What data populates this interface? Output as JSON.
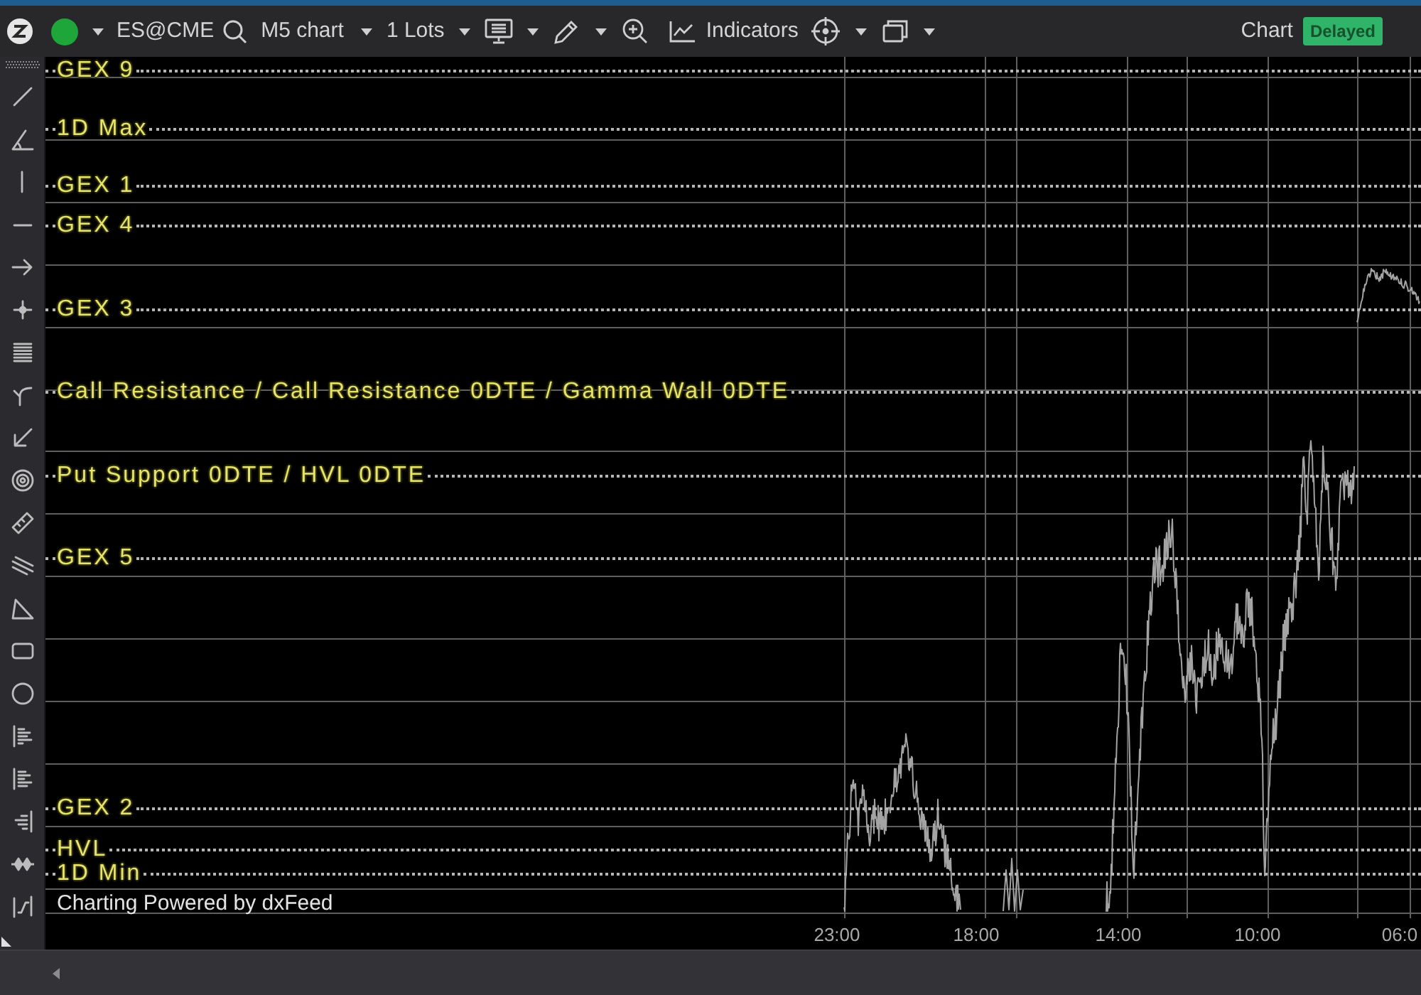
{
  "toolbar": {
    "color_dot": {
      "color": "#1fa63a"
    },
    "symbol": "ES@CME",
    "timeframe": "M5 chart",
    "quantity": "1 Lots",
    "indicators": "Indicators",
    "chart_label": "Chart",
    "data_status": "Delayed"
  },
  "chart": {
    "levels": [
      "GEX 9",
      "1D Max",
      "GEX 1",
      "GEX 4",
      "GEX 3",
      "Call Resistance / Call Resistance 0DTE / Gamma Wall 0DTE",
      "Put Support 0DTE / HVL 0DTE",
      "GEX 5",
      "GEX 2",
      "HVL",
      "1D Min"
    ],
    "attribution": "Charting Powered by dxFeed",
    "time_axis": [
      "23:00",
      "18:00",
      "14:00",
      "10:00",
      "06:0"
    ]
  }
}
